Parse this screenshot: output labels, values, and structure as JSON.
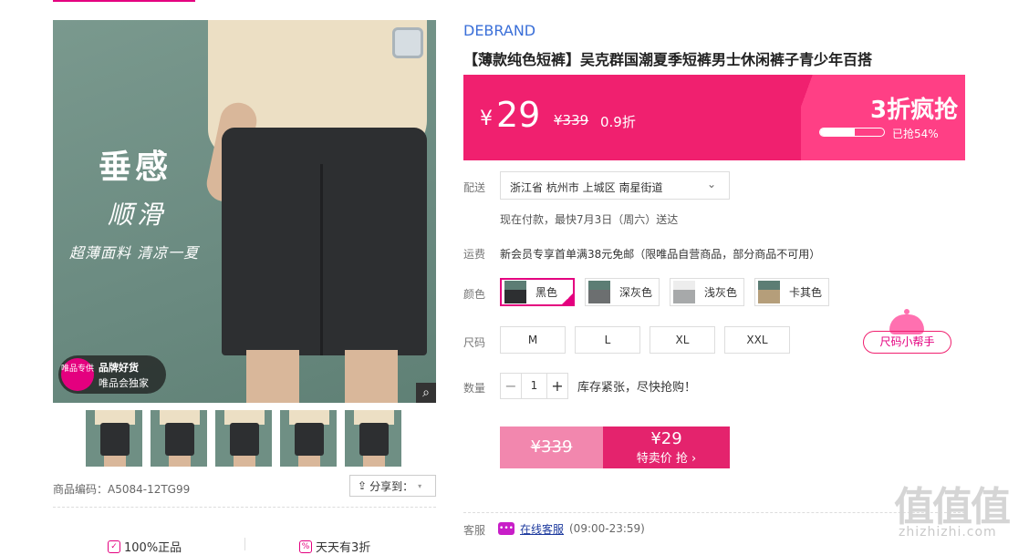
{
  "gallery": {
    "slogan_main": "垂感",
    "slogan_sub": "顺滑",
    "slogan_tag": "超薄面料 清凉一夏",
    "badge_circle": "唯品专供",
    "badge_line1": "品牌好货",
    "badge_line2": "唯品会独家",
    "zoom_icon": "search-icon",
    "thumbnail_count": 5
  },
  "meta": {
    "code": "商品编码：A5084-12TG99",
    "share_label": "分享到："
  },
  "promises": [
    {
      "icon": "shield-check-icon",
      "label": "100%正品"
    },
    {
      "icon": "percent-icon",
      "label": "天天有3折"
    }
  ],
  "product": {
    "brand": "DEBRAND",
    "title": "【薄款纯色短裤】吴克群国潮夏季短裤男士休闲裤子青少年百搭"
  },
  "price": {
    "currency": "¥",
    "current": "29",
    "original": "¥339",
    "discount": "0.9折",
    "flash_label": "3折疯抢",
    "sold_text": "已抢54%",
    "sold_fraction": 0.54,
    "accent": "#f0206f"
  },
  "labels": {
    "delivery": "配送",
    "shipping": "运费",
    "color": "颜色",
    "size": "尺码",
    "quantity": "数量",
    "service": "客服"
  },
  "delivery": {
    "address": "浙江省 杭州市 上城区 南星街道",
    "eta": "现在付款，最快7月3日（周六）送达"
  },
  "shipping": {
    "text": "新会员专享首单满38元免邮（限唯品自营商品，部分商品不可用）"
  },
  "colors": [
    {
      "label": "黑色",
      "selected": true
    },
    {
      "label": "深灰色",
      "selected": false
    },
    {
      "label": "浅灰色",
      "selected": false
    },
    {
      "label": "卡其色",
      "selected": false
    }
  ],
  "sizes": [
    "M",
    "L",
    "XL",
    "XXL"
  ],
  "size_helper": "尺码小帮手",
  "quantity": {
    "value": "1",
    "minus": "−",
    "plus": "+",
    "stock_note": "库存紧张，尽快抢购！"
  },
  "buy": {
    "original": "¥339",
    "price": "¥29",
    "cta": "特卖价 抢 ›"
  },
  "service": {
    "link": "在线客服",
    "hours": "(09:00-23:59)"
  },
  "watermark": {
    "logo": "值值值",
    "url": "zhizhizhi.com"
  }
}
